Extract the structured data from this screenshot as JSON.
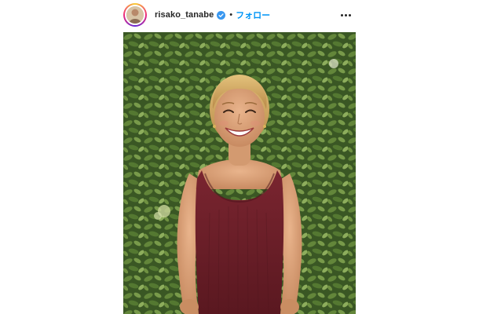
{
  "post": {
    "username": "risako_tanabe",
    "separator": "•",
    "follow_label": "フォロー",
    "verified_icon": "verified-badge-icon",
    "more_icon": "more-options-icon"
  },
  "colors": {
    "follow_blue": "#0095f6",
    "verified_blue": "#3897f0",
    "text_dark": "#262626",
    "foliage": "#4a6b2e",
    "tank_top": "#6b1f26"
  }
}
